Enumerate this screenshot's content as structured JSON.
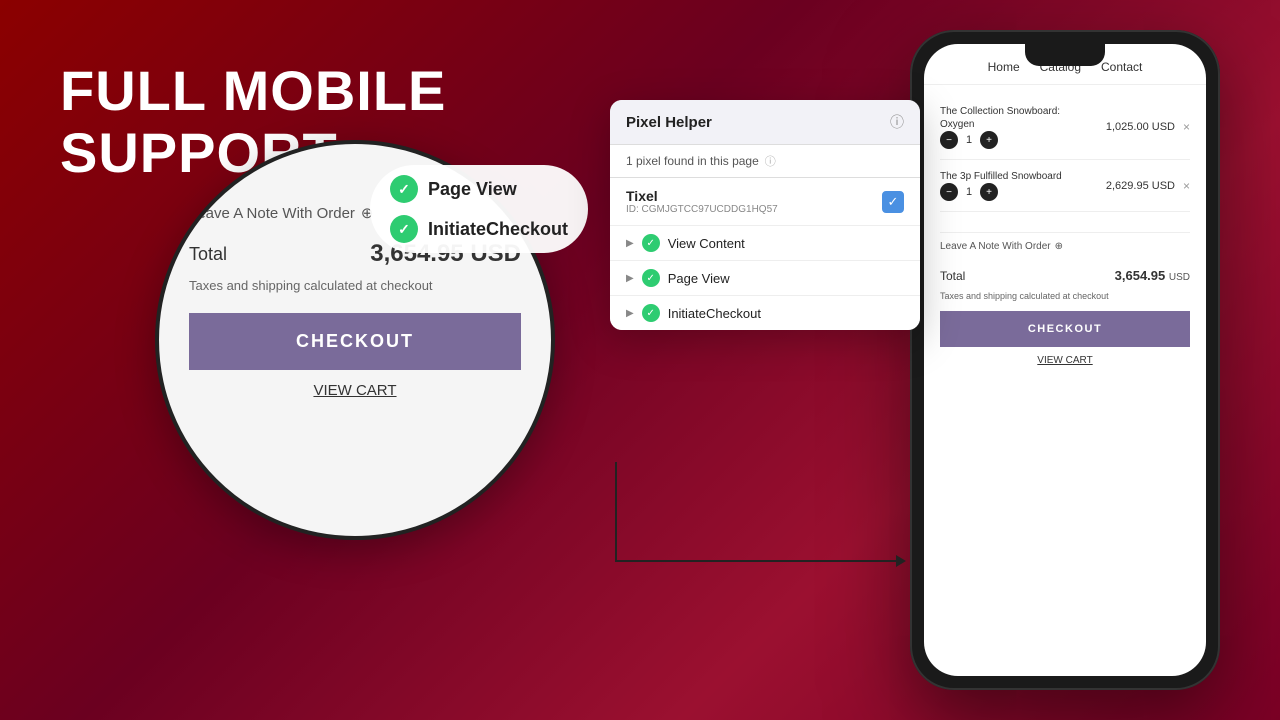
{
  "headline": {
    "line1": "FULL MOBILE",
    "line2": "SUPPORT"
  },
  "phone": {
    "nav": {
      "items": [
        "Home",
        "Catalog",
        "Contact"
      ]
    },
    "products": [
      {
        "name": "The Collection Snowboard: Oxygen",
        "qty": 1,
        "price": "1,025.00 USD"
      },
      {
        "name": "The 3p Fulfilled Snowboard",
        "qty": 1,
        "price": "2,629.95 USD"
      }
    ],
    "note_label": "Leave A Note With Order",
    "total_label": "Total",
    "total_amount": "3,654.95",
    "total_currency": "USD",
    "tax_note": "Taxes and shipping calculated at checkout",
    "checkout_label": "CHECKOUT",
    "view_cart_label": "VIEW CART"
  },
  "zoom": {
    "note_label": "Leave A Note With Order",
    "total_label": "Total",
    "total_amount": "3,654.95 USD",
    "tax_note": "Taxes and shipping calculated at checkout",
    "checkout_label": "CHECKOUT",
    "view_cart_label": "VIEW CART",
    "badges": [
      {
        "label": "Page View"
      },
      {
        "label": "InitiateCheckout"
      }
    ]
  },
  "pixel_helper": {
    "title": "Pixel Helper",
    "info_icon": "ⓘ",
    "found_text": "1 pixel found in this page",
    "tixel_name": "Tixel",
    "tixel_id": "ID: CGMJGTCC97UCDDG1HQ57",
    "events": [
      {
        "name": "View Content"
      },
      {
        "name": "Page View"
      },
      {
        "name": "InitiateCheckout"
      }
    ]
  }
}
